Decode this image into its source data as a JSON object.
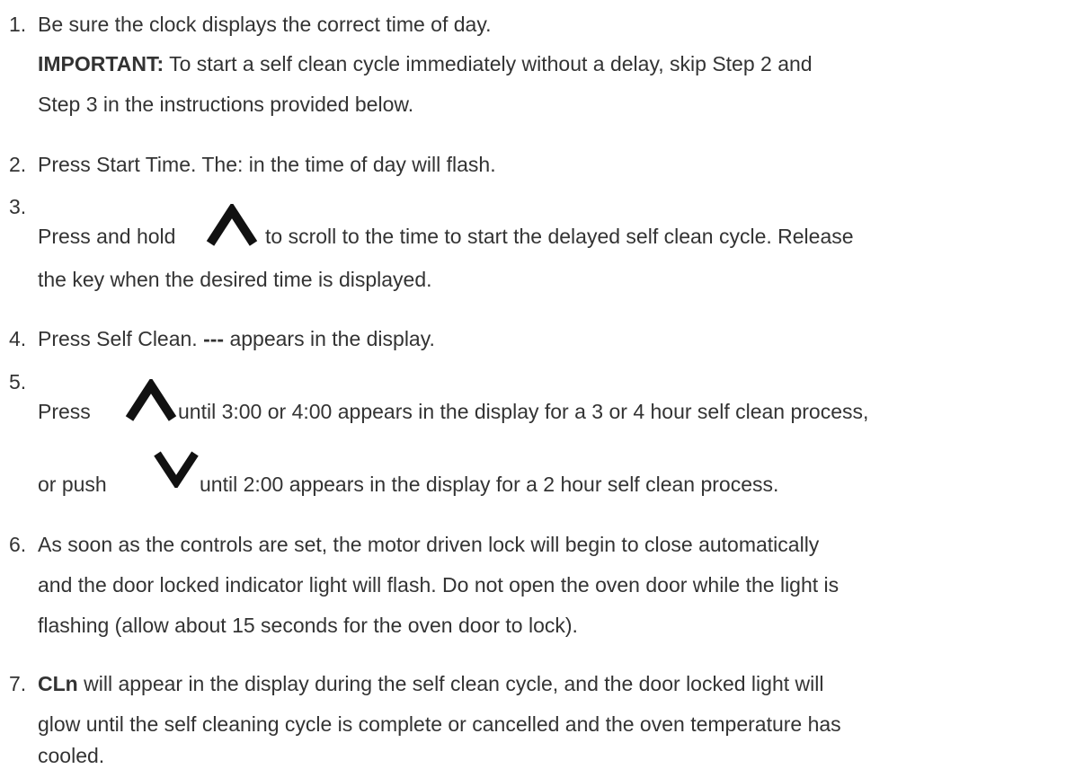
{
  "colors": {
    "text": "#333333",
    "icon": "#111111"
  },
  "steps": [
    {
      "number": "1.",
      "line1": "Be sure the clock displays the correct time of day.",
      "important_label": "IMPORTANT:",
      "important_line1": " To start a self clean cycle immediately without a delay, skip Step 2 and",
      "important_line2": "Step 3 in the instructions provided below."
    },
    {
      "number": "2.",
      "line1": "Press Start Time. The: in the time of day will flash."
    },
    {
      "number": "3.",
      "pre_icon": "Press and hold ",
      "icon": "chevron-up-icon",
      "post_icon": " to scroll to the time to start the delayed self clean cycle. Release",
      "line2": "the key when the desired time is displayed."
    },
    {
      "number": "4.",
      "pre_bold": "Press Self Clean. ",
      "bold": "---",
      "post_bold": " appears in the display."
    },
    {
      "number": "5.",
      "pre_icon": "Press ",
      "icon": "chevron-up-icon",
      "post_icon": " until 3:00 or 4:00 appears in the display for a 3 or 4 hour self clean process,",
      "pre_icon2": "or push ",
      "icon2": "chevron-down-icon",
      "post_icon2": " until 2:00 appears in the display for a 2 hour self clean process."
    },
    {
      "number": "6.",
      "line1": "As soon as the controls are set, the motor driven lock will begin to close automatically",
      "line2": "and the door locked indicator light will flash. Do not open the oven door while the light is",
      "line3": "flashing (allow about 15 seconds for the oven door to lock)."
    },
    {
      "number": "7.",
      "bold": "CLn",
      "line1_rest": " will appear in the display during the self clean cycle, and the door locked light will",
      "line2": "glow until the self cleaning cycle is complete or cancelled and the oven temperature has",
      "line3": "cooled."
    }
  ]
}
